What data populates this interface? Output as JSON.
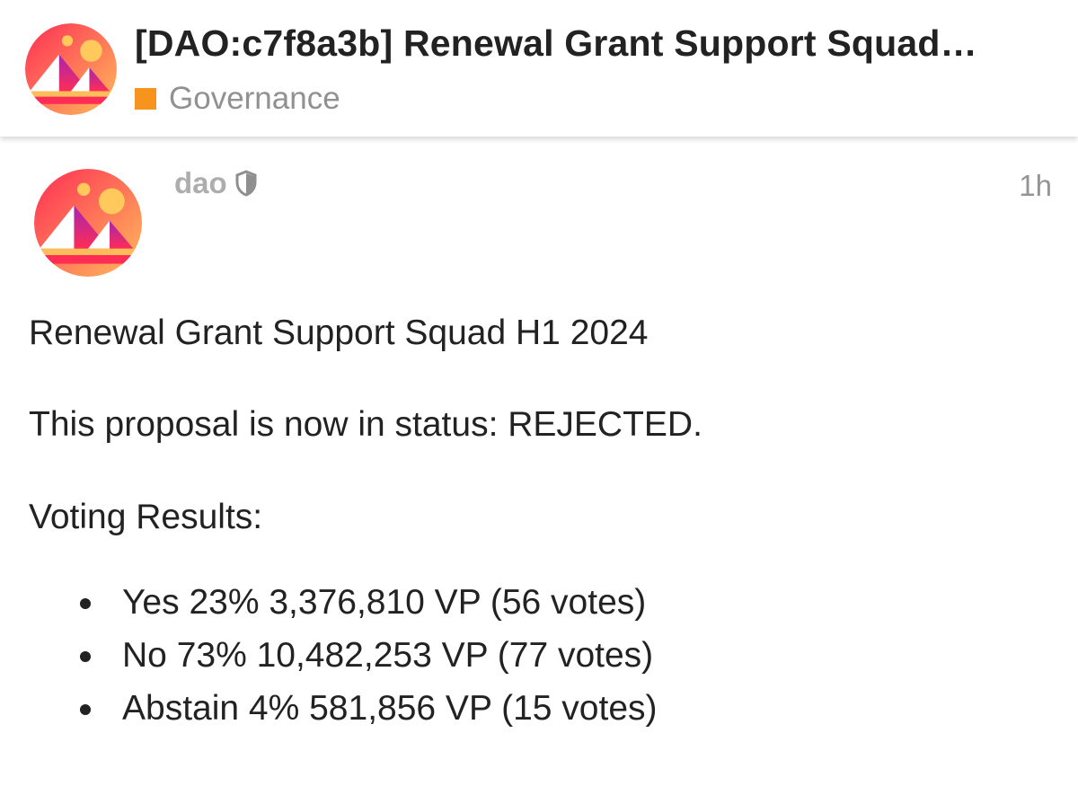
{
  "header": {
    "title": "[DAO:c7f8a3b] Renewal Grant Support Squad…",
    "category": {
      "name": "Governance",
      "color": "#f7941d"
    },
    "logo_icon": "decentraland-logo-icon"
  },
  "post": {
    "username": "dao",
    "badge_icon": "shield-icon",
    "time": "1h",
    "avatar_icon": "decentraland-logo-icon",
    "body": {
      "title": "Renewal Grant Support Squad H1 2024",
      "status_text": "This proposal is now in status: REJECTED.",
      "results_heading": "Voting Results:",
      "results": [
        {
          "text": "Yes 23% 3,376,810 VP (56 votes)"
        },
        {
          "text": "No 73% 10,482,253 VP (77 votes)"
        },
        {
          "text": "Abstain 4% 581,856 VP (15 votes)"
        }
      ]
    }
  },
  "colors": {
    "text": "#222222",
    "muted": "#919191",
    "username": "#adadad",
    "logo_gradient_top": "#ff2d55",
    "logo_gradient_bottom": "#ffbc5b"
  }
}
